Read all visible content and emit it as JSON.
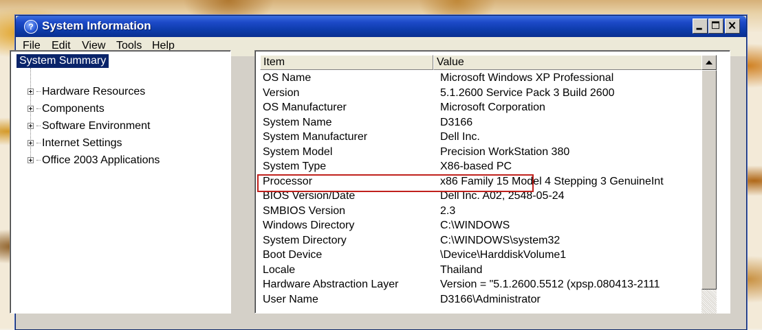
{
  "window": {
    "title": "System Information",
    "icon": "help-question-icon"
  },
  "menu": {
    "items": [
      "File",
      "Edit",
      "View",
      "Tools",
      "Help"
    ]
  },
  "tree": {
    "root": "System Summary",
    "children": [
      "Hardware Resources",
      "Components",
      "Software Environment",
      "Internet Settings",
      "Office 2003 Applications"
    ]
  },
  "table": {
    "columns": [
      "Item",
      "Value"
    ],
    "rows": [
      {
        "item": "OS Name",
        "value": "Microsoft Windows XP Professional"
      },
      {
        "item": "Version",
        "value": "5.1.2600 Service Pack 3 Build 2600"
      },
      {
        "item": "OS Manufacturer",
        "value": "Microsoft Corporation"
      },
      {
        "item": "System Name",
        "value": "D3166"
      },
      {
        "item": "System Manufacturer",
        "value": "Dell Inc."
      },
      {
        "item": "System Model",
        "value": "Precision WorkStation 380"
      },
      {
        "item": "System Type",
        "value": "X86-based PC"
      },
      {
        "item": "Processor",
        "value": "x86 Family 15 Model 4 Stepping 3 GenuineInt"
      },
      {
        "item": "BIOS Version/Date",
        "value": "Dell Inc. A02, 2548-05-24"
      },
      {
        "item": "SMBIOS Version",
        "value": "2.3"
      },
      {
        "item": "Windows Directory",
        "value": "C:\\WINDOWS"
      },
      {
        "item": "System Directory",
        "value": "C:\\WINDOWS\\system32"
      },
      {
        "item": "Boot Device",
        "value": "\\Device\\HarddiskVolume1"
      },
      {
        "item": "Locale",
        "value": "Thailand"
      },
      {
        "item": "Hardware Abstraction Layer",
        "value": "Version = \"5.1.2600.5512 (xpsp.080413-2111"
      },
      {
        "item": "User Name",
        "value": "D3166\\Administrator"
      }
    ],
    "highlighted_item": "System Type"
  },
  "colors": {
    "titlebar": "#0c3aa8",
    "selection": "#0a246a",
    "highlight_box": "#c0201c"
  }
}
